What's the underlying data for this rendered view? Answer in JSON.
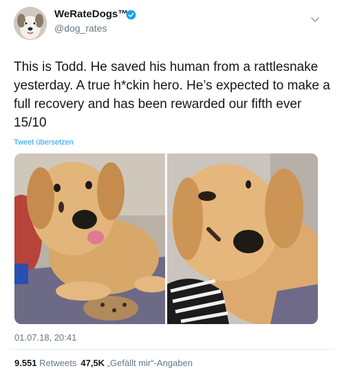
{
  "account": {
    "display_name": "WeRateDogs™",
    "handle": "@dog_rates"
  },
  "tweet": {
    "text": "This is Todd. He saved his human from a rattlesnake yesterday. A true h*ckin hero. He’s expected to make a full recovery and has been rewarded our fifth ever 15/10",
    "translate_label": "Tweet übersetzen",
    "timestamp": "01.07.18, 20:41"
  },
  "stats": {
    "retweets_count": "9.551",
    "retweets_label": "Retweets",
    "likes_count": "47,5K",
    "likes_label": "„Gefällt mir“-Angaben"
  },
  "colors": {
    "link": "#1da1f2",
    "secondary_text": "#657786",
    "verified_badge": "#1da1f2"
  },
  "icons": [
    "verified-badge-icon",
    "chevron-down-icon"
  ]
}
